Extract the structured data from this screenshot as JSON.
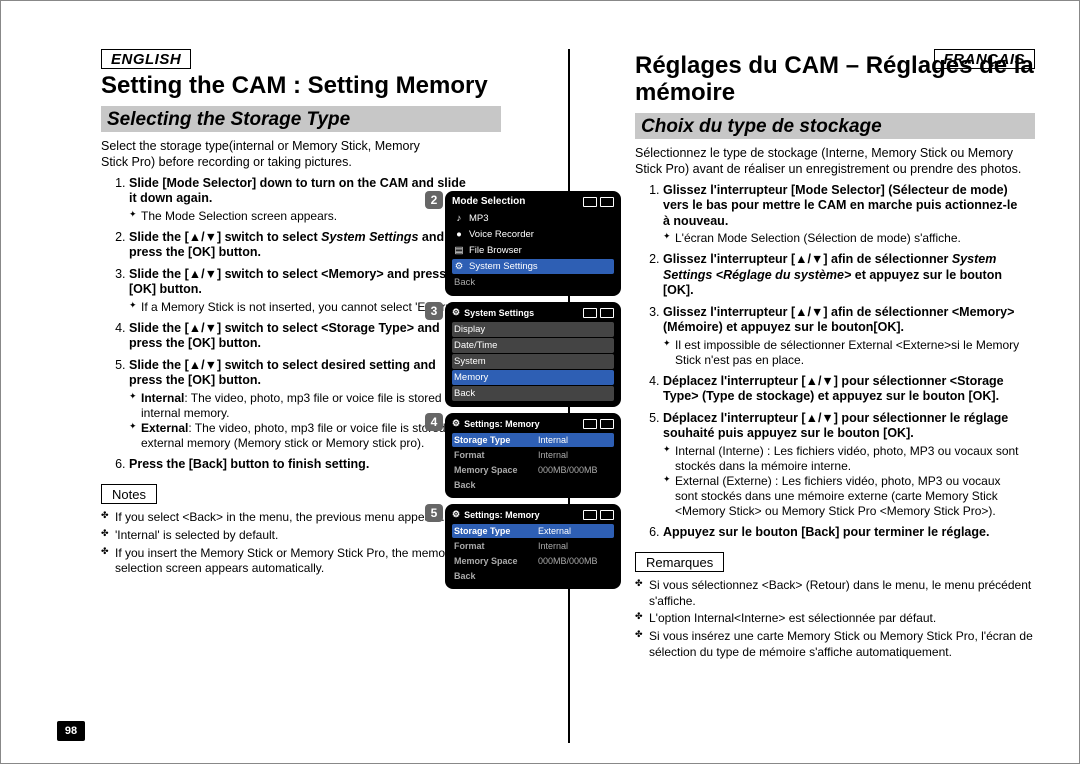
{
  "left": {
    "lang": "ENGLISH",
    "title": "Setting the CAM : Setting Memory",
    "subtitle": "Selecting the Storage Type",
    "intro": "Select the storage type(internal or Memory Stick, Memory Stick Pro) before recording or taking pictures.",
    "steps": [
      {
        "t": "Slide [Mode Selector] down to turn on the CAM and slide it down again.",
        "sub": [
          "The Mode Selection screen appears."
        ]
      },
      {
        "t": "Slide the [▲/▼] switch to select ",
        "it": "System Settings",
        "t2": " and press the [OK] button."
      },
      {
        "t": "Slide the [▲/▼] switch to select <Memory> and press the [OK] button.",
        "sub": [
          "If a Memory Stick is not inserted, you cannot select 'External'."
        ]
      },
      {
        "t": "Slide the [▲/▼] switch to select <Storage Type> and press the [OK] button."
      },
      {
        "t": "Slide the [▲/▼] switch to select desired setting and press the [OK] button.",
        "sub": [
          "Internal: The video, photo, mp3 file or voice file is stored in internal memory.",
          "External: The video, photo, mp3 file or voice file is stored in external memory (Memory stick or Memory stick pro)."
        ]
      },
      {
        "t": "Press the [Back] button to finish setting."
      }
    ],
    "notes_label": "Notes",
    "notes": [
      "If you select <Back> in the menu, the previous menu appears.",
      "'Internal' is selected by default.",
      "If you insert the Memory Stick or Memory Stick Pro, the memory type selection screen appears automatically."
    ]
  },
  "right": {
    "lang": "FRANÇAIS",
    "title": "Réglages du CAM – Réglages de la mémoire",
    "subtitle": "Choix du type de stockage",
    "intro": "Sélectionnez le type de stockage (Interne, Memory Stick ou Memory Stick Pro) avant de réaliser un enregistrement ou prendre des photos.",
    "steps": [
      {
        "t": "Glissez l'interrupteur [Mode Selector] (Sélecteur de mode) vers le bas pour mettre le CAM en marche puis actionnez-le à nouveau.",
        "sub": [
          "L'écran Mode Selection (Sélection de mode) s'affiche."
        ]
      },
      {
        "t": "Glissez l'interrupteur [▲/▼] afin de sélectionner ",
        "it": "System Settings <Réglage du système>",
        "t2": " et appuyez sur le bouton [OK]."
      },
      {
        "t": "Glissez l'interrupteur [▲/▼] afin de sélectionner <Memory> (Mémoire) et appuyez sur le bouton[OK].",
        "sub": [
          "Il est impossible de sélectionner External <Externe>si le Memory Stick n'est pas en place."
        ]
      },
      {
        "t": "Déplacez l'interrupteur [▲/▼] pour sélectionner <Storage Type> (Type de stockage) et appuyez sur le bouton [OK]."
      },
      {
        "t": "Déplacez l'interrupteur [▲/▼] pour sélectionner le réglage souhaité puis appuyez sur le bouton [OK].",
        "sub": [
          "Internal (Interne) : Les fichiers vidéo, photo, MP3 ou vocaux sont stockés dans la mémoire interne.",
          "External (Externe) : Les fichiers vidéo, photo, MP3 ou vocaux sont stockés dans une mémoire externe (carte Memory Stick <Memory Stick> ou Memory Stick Pro <Memory Stick Pro>)."
        ]
      },
      {
        "t": "Appuyez sur le bouton [Back] pour terminer le réglage."
      }
    ],
    "notes_label": "Remarques",
    "notes": [
      "Si vous sélectionnez <Back> (Retour) dans le menu, le menu précédent s'affiche.",
      "L'option Internal<Interne> est sélectionnée par défaut.",
      "Si vous insérez une carte Memory Stick ou Memory Stick Pro, l'écran de sélection du type de mémoire s'affiche automatiquement."
    ]
  },
  "page_number": "98",
  "screens": {
    "s2": {
      "title": "Mode Selection",
      "items": [
        "MP3",
        "Voice Recorder",
        "File Browser"
      ],
      "selected": "System Settings",
      "back": "Back"
    },
    "s3": {
      "title": "System Settings",
      "items": [
        "Display",
        "Date/Time",
        "System"
      ],
      "selected": "Memory",
      "back": "Back"
    },
    "s4": {
      "title": "Settings: Memory",
      "rows": [
        {
          "k": "Storage Type",
          "v": "Internal",
          "sel": true
        },
        {
          "k": "Format",
          "v": "Internal"
        },
        {
          "k": "Memory Space",
          "v": "000MB/000MB"
        },
        {
          "k": "Back",
          "v": ""
        }
      ]
    },
    "s5": {
      "title": "Settings: Memory",
      "rows": [
        {
          "k": "Storage Type",
          "v": "External",
          "sel": true
        },
        {
          "k": "Format",
          "v": "Internal"
        },
        {
          "k": "Memory Space",
          "v": "000MB/000MB"
        },
        {
          "k": "Back",
          "v": ""
        }
      ]
    }
  }
}
